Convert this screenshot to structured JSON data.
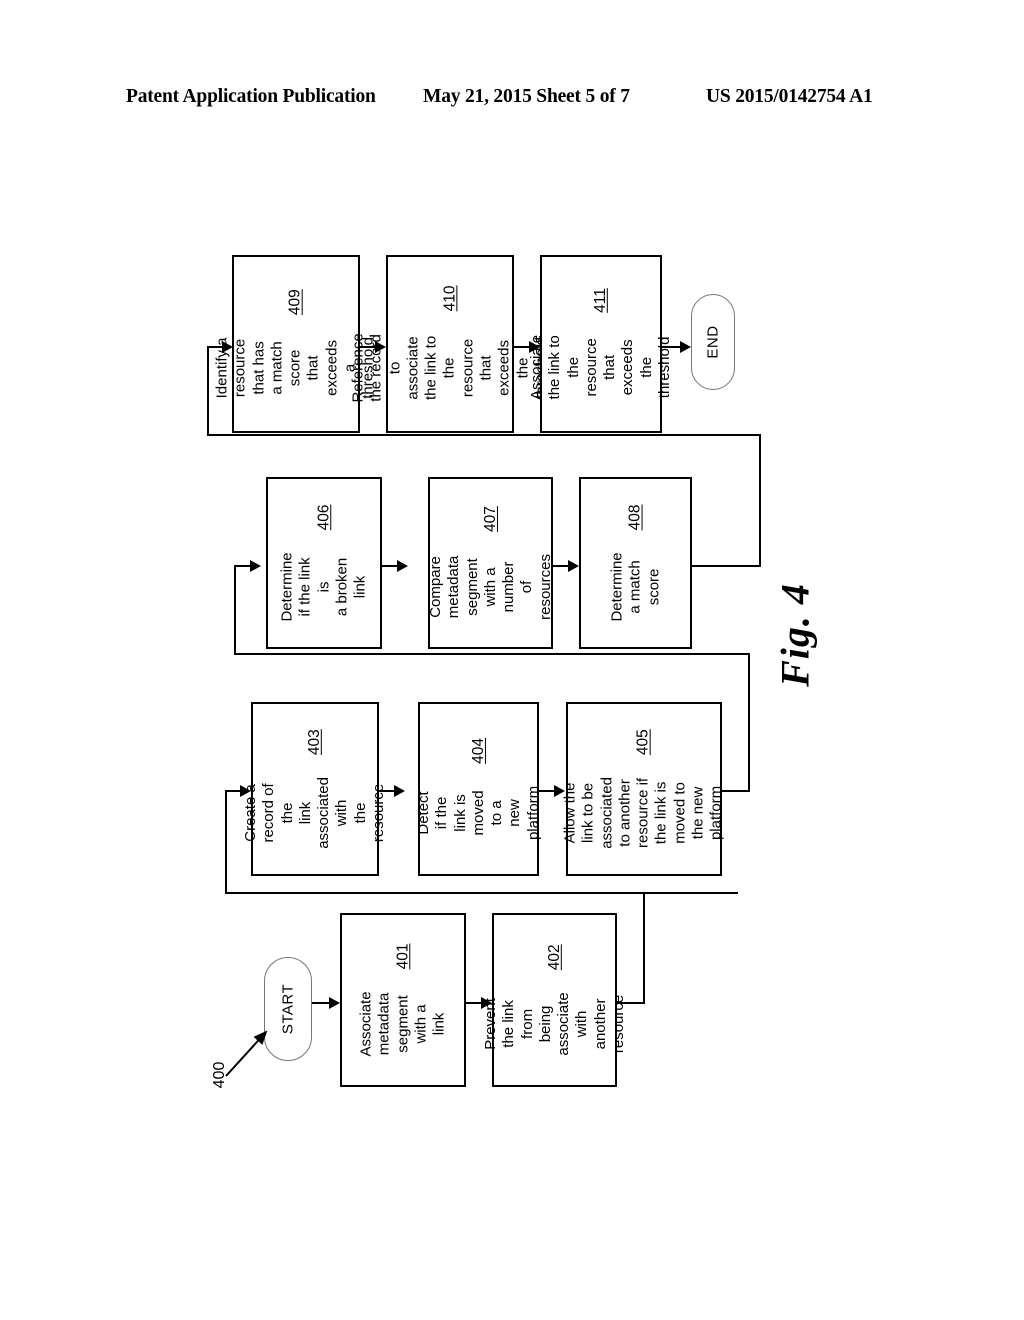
{
  "header": {
    "publication": "Patent Application Publication",
    "date_sheet": "May 21, 2015  Sheet 5 of 7",
    "patent_number": "US 2015/0142754 A1"
  },
  "figure": {
    "caption": "Fig. 4",
    "reference_numeral": "400",
    "orientation": "landscape-rotated-90",
    "start_label": "START",
    "end_label": "END"
  },
  "flowchart": {
    "type": "process-flow",
    "nodes": [
      {
        "id": "start",
        "kind": "terminator",
        "label": "START"
      },
      {
        "id": "401",
        "kind": "process",
        "number": "401",
        "text": "Associate metadata\nsegment with a link"
      },
      {
        "id": "402",
        "kind": "process",
        "number": "402",
        "text": "Prevent the link from\nbeing associate with\nanother resource"
      },
      {
        "id": "403",
        "kind": "process",
        "number": "403",
        "text": "Create a record of the\nlink associated with\nthe resource"
      },
      {
        "id": "404",
        "kind": "process",
        "number": "404",
        "text": "Detect if the link is\nmoved to a new\nplatform"
      },
      {
        "id": "405",
        "kind": "process",
        "number": "405",
        "text": "Allow the link to be\nassociated to another\nresource if the link is\nmoved to the new\nplatform"
      },
      {
        "id": "406",
        "kind": "process",
        "number": "406",
        "text": "Determine if the link is\na broken link"
      },
      {
        "id": "407",
        "kind": "process",
        "number": "407",
        "text": "Compare metadata\nsegment with a\nnumber of resources"
      },
      {
        "id": "408",
        "kind": "process",
        "number": "408",
        "text": "Determine a match\nscore"
      },
      {
        "id": "409",
        "kind": "process",
        "number": "409",
        "text": "Identify a resource\nthat has a match\nscore that exceeds a\nthreshold"
      },
      {
        "id": "410",
        "kind": "process",
        "number": "410",
        "text": "Reference the record\nto associate the link to\nthe resource that\nexceeds the threshold"
      },
      {
        "id": "411",
        "kind": "process",
        "number": "411",
        "text": "Associate the link to\nthe resource that\nexceeds the threshold"
      },
      {
        "id": "end",
        "kind": "terminator",
        "label": "END"
      }
    ],
    "edges": [
      {
        "from": "start",
        "to": "401"
      },
      {
        "from": "401",
        "to": "402"
      },
      {
        "from": "402",
        "to": "403"
      },
      {
        "from": "403",
        "to": "404"
      },
      {
        "from": "404",
        "to": "405"
      },
      {
        "from": "405",
        "to": "406"
      },
      {
        "from": "406",
        "to": "407"
      },
      {
        "from": "407",
        "to": "408"
      },
      {
        "from": "408",
        "to": "409"
      },
      {
        "from": "409",
        "to": "410"
      },
      {
        "from": "410",
        "to": "411"
      },
      {
        "from": "411",
        "to": "end"
      }
    ]
  },
  "colors": {
    "ink": "#000000",
    "paper": "#ffffff",
    "terminator_stroke": "#777777"
  }
}
